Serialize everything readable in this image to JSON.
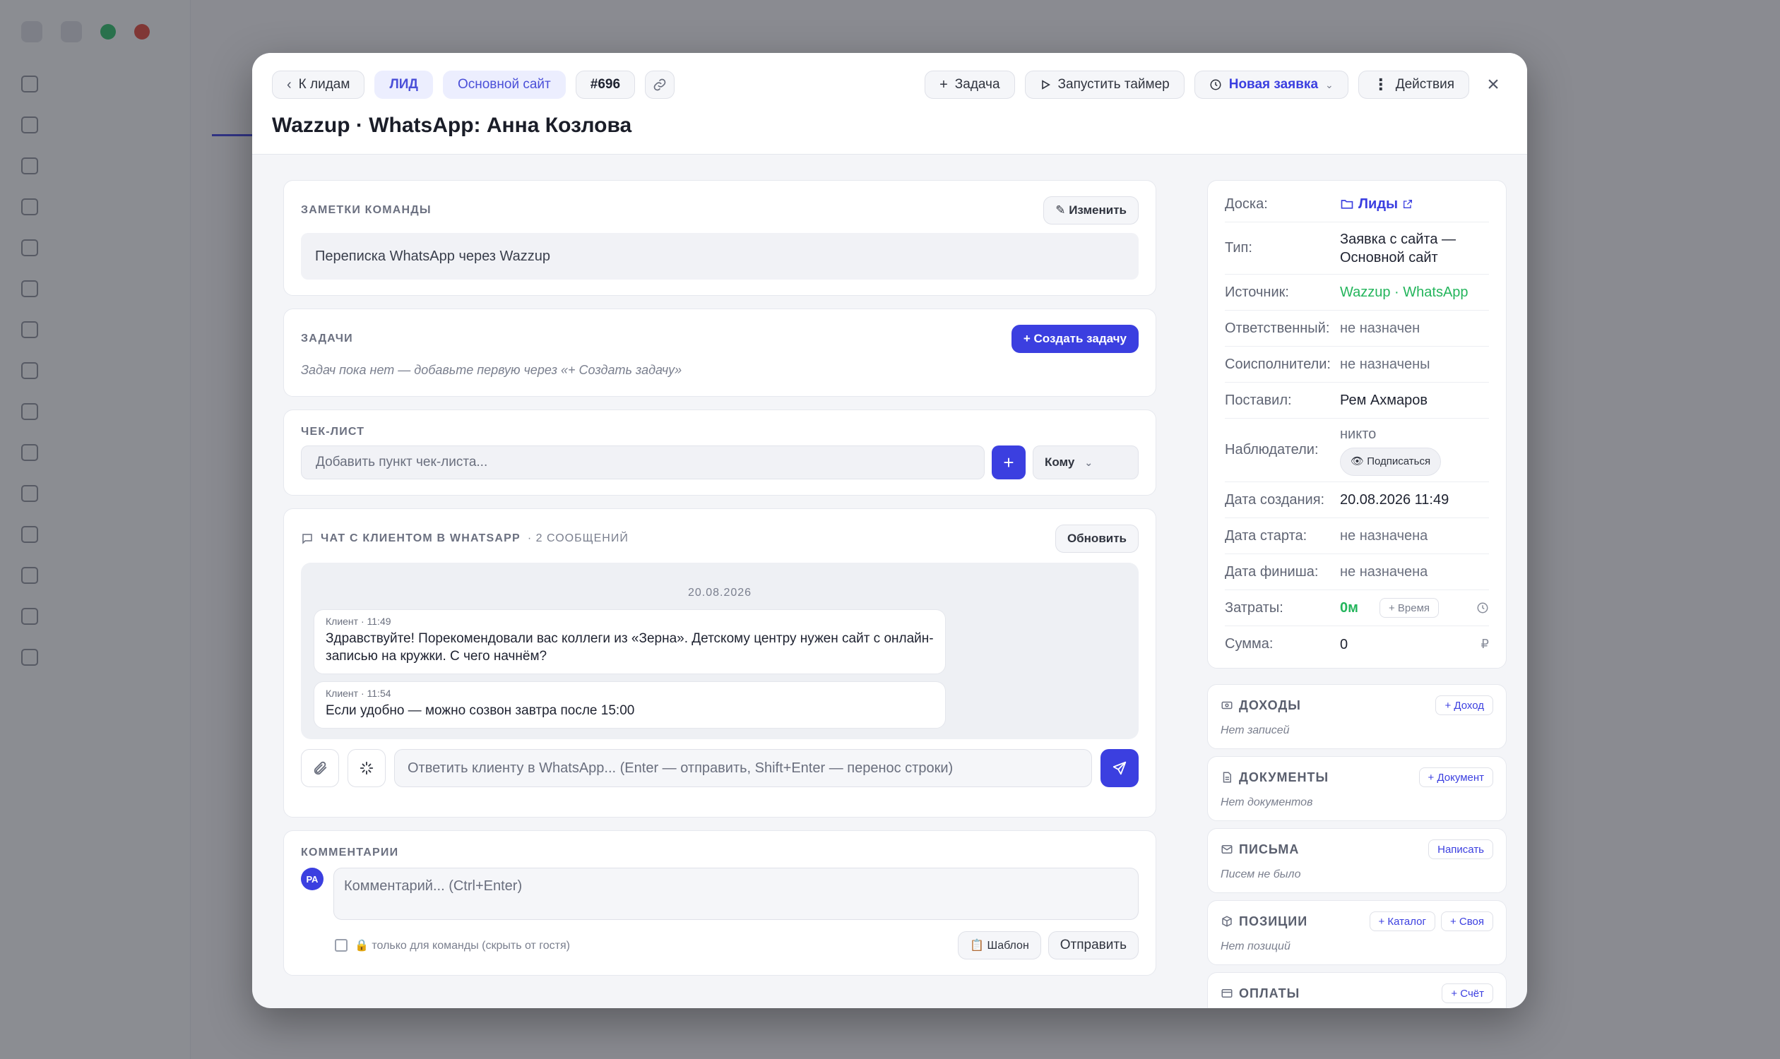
{
  "background": {
    "nav": [
      "",
      "",
      "",
      "",
      "",
      "",
      "",
      "",
      "",
      "",
      "",
      "",
      "",
      "",
      ""
    ],
    "logout": ""
  },
  "header": {
    "back_label": "К лидам",
    "tag_lead": "ЛИД",
    "tag_site": "Основной сайт",
    "id_badge": "#696",
    "task_label": "Задача",
    "timer_label": "Запустить таймер",
    "status_label": "Новая заявка",
    "actions_label": "Действия",
    "title": "Wazzup · WhatsApp: Анна Козлова"
  },
  "notes": {
    "title": "ЗАМЕТКИ КОМАНДЫ",
    "edit_label": "✎ Изменить",
    "text": "Переписка WhatsApp через Wazzup"
  },
  "tasks": {
    "title": "ЗАДАЧИ",
    "create_label": "+ Создать задачу",
    "empty": "Задач пока нет — добавьте первую через «+ Создать задачу»"
  },
  "checklist": {
    "title": "ЧЕК-ЛИСТ",
    "placeholder": "Добавить пункт чек-листа...",
    "add_label": "+",
    "assignee_label": "Кому"
  },
  "chat": {
    "title": "ЧАТ С КЛИЕНТОМ В WHATSAPP",
    "count": "· 2 СООБЩЕНИЙ",
    "refresh_label": "Обновить",
    "date": "20.08.2026",
    "messages": [
      {
        "meta": "Клиент · 11:49",
        "text": "Здравствуйте! Порекомендовали вас коллеги из «Зерна». Детскому центру нужен сайт с онлайн-записью на кружки. С чего начнём?"
      },
      {
        "meta": "Клиент · 11:54",
        "text": "Если удобно — можно созвон завтра после 15:00"
      }
    ],
    "reply_placeholder": "Ответить клиенту в WhatsApp... (Enter — отправить, Shift+Enter — перенос строки)"
  },
  "comments": {
    "title": "КОММЕНТАРИИ",
    "avatar": "РА",
    "placeholder": "Комментарий... (Ctrl+Enter)",
    "private_hint": "🔒 только для команды (скрыть от гостя)",
    "template_label": "📋 Шаблон",
    "send_label": "Отправить"
  },
  "info": {
    "board_label": "Доска:",
    "board_value": "Лиды",
    "type_label": "Тип:",
    "type_value": "Заявка с сайта — Основной сайт",
    "source_label": "Источник:",
    "source_value": "Wazzup · WhatsApp",
    "owner_label": "Ответственный:",
    "owner_value": "не назначен",
    "coexec_label": "Соисполнители:",
    "coexec_value": "не назначены",
    "author_label": "Поставил:",
    "author_value": "Рем Ахмаров",
    "watchers_label": "Наблюдатели:",
    "watchers_value": "никто",
    "subscribe_label": "👁 Подписаться",
    "created_label": "Дата создания:",
    "created_value": "20.08.2026 11:49",
    "start_label": "Дата старта:",
    "start_value": "не назначена",
    "finish_label": "Дата финиша:",
    "finish_value": "не назначена",
    "cost_label": "Затраты:",
    "cost_value": "0м",
    "time_label": "+ Время",
    "sum_label": "Сумма:",
    "sum_value": "0",
    "currency": "₽"
  },
  "finance": [
    {
      "title": "ДОХОДЫ",
      "buttons": [
        "+ Доход"
      ],
      "empty": "Нет записей",
      "icon": "money-icon"
    },
    {
      "title": "ДОКУМЕНТЫ",
      "buttons": [
        "+ Документ"
      ],
      "empty": "Нет документов",
      "icon": "document-icon"
    },
    {
      "title": "ПИСЬМА",
      "buttons": [
        "Написать"
      ],
      "empty": "Писем не было",
      "icon": "mail-icon"
    },
    {
      "title": "ПОЗИЦИИ",
      "buttons": [
        "+ Каталог",
        "+ Своя"
      ],
      "empty": "Нет позиций",
      "icon": "box-icon"
    },
    {
      "title": "ОПЛАТЫ",
      "buttons": [
        "+ Счёт"
      ],
      "empty": "",
      "icon": "card-icon"
    }
  ],
  "colors": {
    "accent": "#3b3fe0",
    "green": "#24b55c"
  }
}
